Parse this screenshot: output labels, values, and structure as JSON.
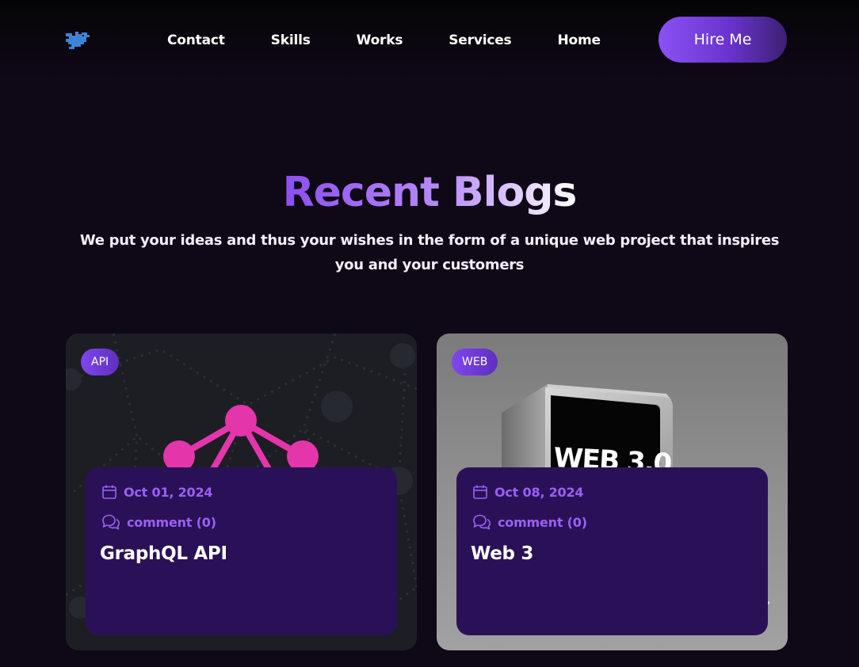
{
  "nav": {
    "logo_icon": "bird-logo-icon",
    "links": [
      "Contact",
      "Skills",
      "Works",
      "Services",
      "Home"
    ],
    "cta_label": "Hire Me"
  },
  "colors": {
    "background": "#0f0817",
    "accent": "#8a52f2",
    "card_panel": "#2a1157",
    "meta_text": "#9a60f5",
    "graphql_pink": "#e535ab"
  },
  "blogs": {
    "title": "Recent Blogs",
    "subtitle": "We put your ideas and thus your wishes in the form of a unique web project that inspires you and your customers",
    "posts": [
      {
        "category": "API",
        "date": "Oct 01, 2024",
        "comments": "comment (0)",
        "title": "GraphQL API",
        "image_icon": "graphql-logo-icon"
      },
      {
        "category": "WEB",
        "date": "Oct 08, 2024",
        "comments": "comment (0)",
        "title": "Web 3",
        "image_text": "WEB 3.0",
        "image_icon": "web3-cube-icon"
      }
    ]
  }
}
